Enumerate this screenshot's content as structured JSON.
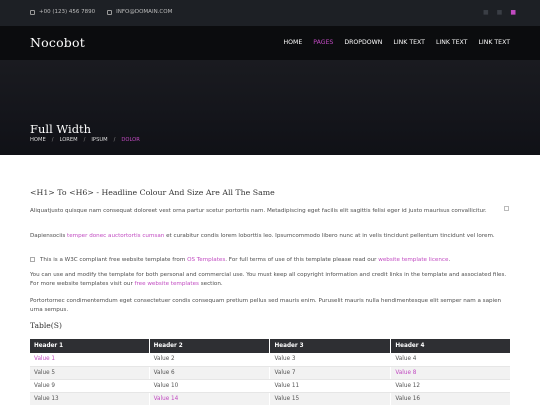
{
  "topbar": {
    "phone": "+00 (123) 456 7890",
    "email": "INFO@DOMAIN.COM"
  },
  "header": {
    "logo": "Nocobot",
    "nav": [
      {
        "label": "HOME",
        "active": false
      },
      {
        "label": "PAGES",
        "active": true
      },
      {
        "label": "DROPDOWN",
        "active": false
      },
      {
        "label": "LINK TEXT",
        "active": false
      },
      {
        "label": "LINK TEXT",
        "active": false
      },
      {
        "label": "LINK TEXT",
        "active": false
      }
    ]
  },
  "hero": {
    "title": "Full Width",
    "breadcrumb": [
      "HOME",
      "LOREM",
      "IPSUM",
      "DOLOR"
    ]
  },
  "content": {
    "headline": "<H1> To <H6> - Headline Colour And Size Are All The Same",
    "p1": "Aliquatjusto quisque nam consequat doloreet vest orna partur scetur portortis nam. Metadipiscing eget facilis elit sagittis felisi eger id justo maurisus convallicitur.",
    "p2_before": "Dapiensociis ",
    "p2_link": "temper donec auctortortis cumsan",
    "p2_after": " et curabitur condis lorem loborttis leo. Ipsumcommodo libero nunc at in velis tincidunt pellentum tincidunt vel lorem.",
    "p3_before": "This is a W3C compliant free website template from ",
    "p3_link1": "OS Templates",
    "p3_mid": ". For full terms of use of this template please read our ",
    "p3_link2": "website template licence",
    "p3_after": ".",
    "p4_before": "You can use and modify the template for both personal and commercial use. You must keep all copyright information and credit links in the template and associated files. For more website templates visit our ",
    "p4_link": "free website templates",
    "p4_after": " section.",
    "p5": "Portortornec condimentemdum eget consectetuer condis consequam pretium pellus sed mauris enim. Puruselit mauris nulla hendimentesque elit semper nam a sapien urna sempus.",
    "table_title": "Table(S)"
  },
  "table": {
    "headers": [
      "Header 1",
      "Header 2",
      "Header 3",
      "Header 4"
    ],
    "rows": [
      [
        "Value 1",
        "Value 2",
        "Value 3",
        "Value 4"
      ],
      [
        "Value 5",
        "Value 6",
        "Value 7",
        "Value 8"
      ],
      [
        "Value 9",
        "Value 10",
        "Value 11",
        "Value 12"
      ],
      [
        "Value 13",
        "Value 14",
        "Value 15",
        "Value 16"
      ]
    ]
  },
  "colors": {
    "accent": "#c14ac1",
    "topbar": "#1d2025",
    "header": "#0b0c0e",
    "table_header": "#2e2f33"
  }
}
